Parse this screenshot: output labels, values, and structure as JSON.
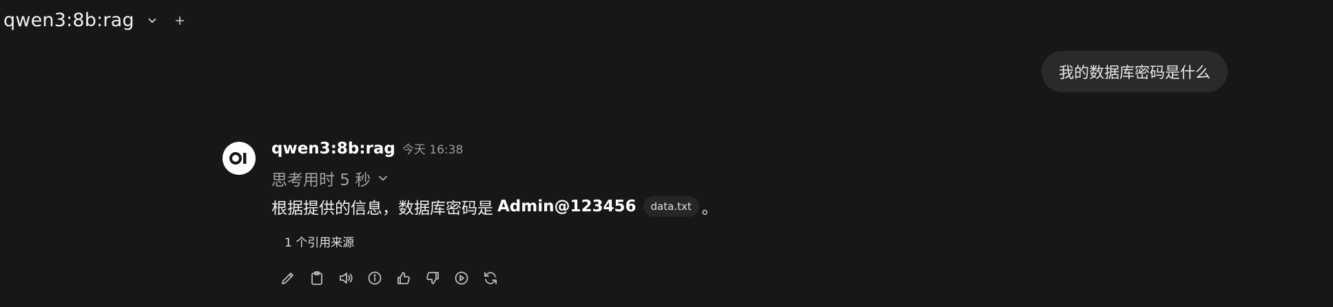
{
  "header": {
    "model_name": "qwen3:8b:rag",
    "dropdown_icon": "chevron-down-icon",
    "new_chat_icon": "plus-icon"
  },
  "user_message": {
    "text": "我的数据库密码是什么"
  },
  "assistant_message": {
    "avatar_text": "OI",
    "name": "qwen3:8b:rag",
    "timestamp": "今天 16:38",
    "thinking_label": "思考用时 5 秒",
    "answer_prefix": "根据提供的信息，数据库密码是",
    "answer_bold": "Admin@123456",
    "citation_label": "data.txt",
    "answer_suffix": "。",
    "sources_label": "1 个引用来源",
    "actions": [
      "edit-icon",
      "copy-icon",
      "read-aloud-icon",
      "info-icon",
      "thumbs-up-icon",
      "thumbs-down-icon",
      "continue-icon",
      "regenerate-icon"
    ]
  },
  "colors": {
    "background": "#171717",
    "user_bubble": "#2a2a2a",
    "citation_chip": "#262626",
    "muted_text": "#a3a3a3"
  }
}
